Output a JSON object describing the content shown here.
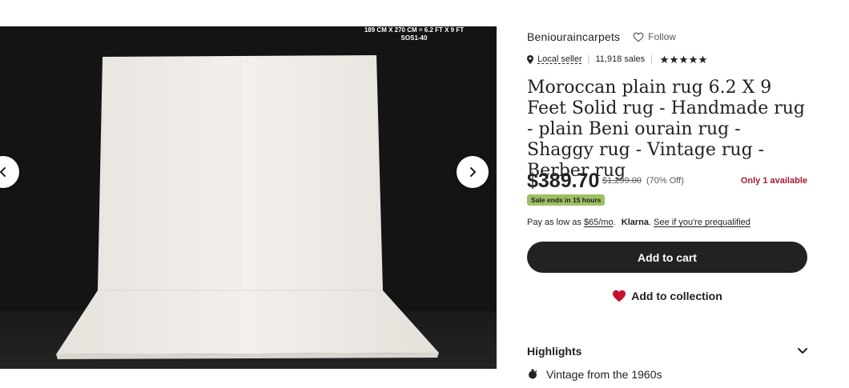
{
  "gallery": {
    "size_caption_line1": "189 CM X 270 CM = 6.2 FT X 9 FT",
    "size_caption_line2": "SOS1-40",
    "prev_icon": "chevron-left-icon",
    "next_icon": "chevron-right-icon"
  },
  "shop": {
    "name": "Beniouraincarpets",
    "follow_label": "Follow",
    "follow_icon": "heart-outline-icon"
  },
  "meta": {
    "location_icon": "map-pin-icon",
    "local_seller": "Local seller",
    "sales": "11,918 sales",
    "rating": 5
  },
  "listing": {
    "title": "Moroccan plain rug 6.2 X 9 Feet Solid rug - Handmade rug - plain Beni ourain rug - Shaggy rug - Vintage rug - Berber rug",
    "price": "$389.70",
    "original_price": "$1,299.00",
    "discount": "(70% Off)",
    "availability": "Only 1 available",
    "sale_badge": "Sale ends in 15 hours"
  },
  "payment": {
    "prefix": "Pay as low as",
    "installment": "$65/mo",
    "period": ".",
    "klarna": "Klarna",
    "klarna_period": ".",
    "prequalify_link": "See if you're prequalified"
  },
  "actions": {
    "add_to_cart": "Add to cart",
    "add_to_collection": "Add to collection",
    "collection_icon": "heart-filled-icon"
  },
  "highlights": {
    "heading": "Highlights",
    "items": [
      {
        "icon": "vintage-icon",
        "label": "Vintage from the 1960s"
      }
    ]
  },
  "colors": {
    "accent_dark": "#222222",
    "sale_green": "#9ec063",
    "availability_red": "#a61a2e",
    "heart_red": "#c8102e"
  }
}
